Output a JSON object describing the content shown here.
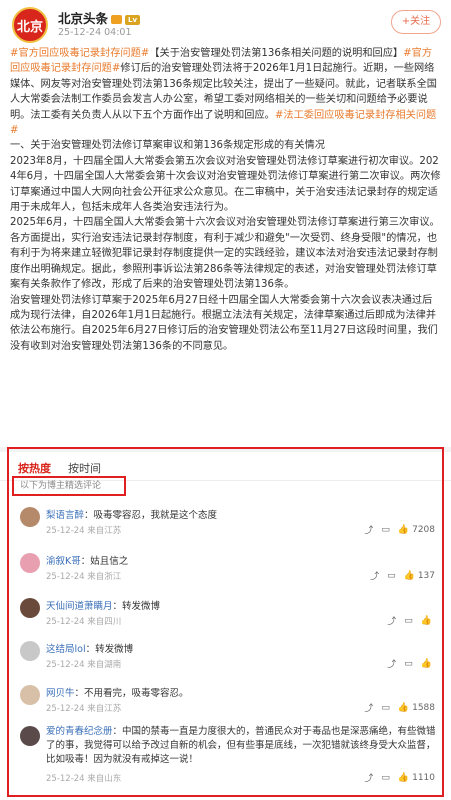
{
  "header": {
    "account_name": "北京头条",
    "avatar_text": "北京",
    "level_badge": "Lv",
    "timestamp": "25-12-24 04:01",
    "follow_label": "+关注"
  },
  "post": {
    "tag1": "#官方回应吸毒记录封存问题#",
    "text1": "【关于治安管理处罚法第136条相关问题的说明和回应】",
    "tag2": "#官方回应吸毒记录封存问题#",
    "text2": "修订后的治安管理处罚法将于2026年1月1日起施行。近期，一些网络媒体、网友等对治安管理处罚法第136条规定比较关注，提出了一些疑问。就此，记者联系全国人大常委会法制工作委员会发言人办公室，希望工委对网络相关的一些关切和问题给予必要说明。法工委有关负责人从以下五个方面作出了说明和回应。",
    "tag3": "#法工委回应吸毒记录封存相关问题#",
    "para1_title": "一、关于治安管理处罚法修订草案审议和第136条规定形成的有关情况",
    "para1_body": "2023年8月，十四届全国人大常委会第五次会议对治安管理处罚法修订草案进行初次审议。2024年6月，十四届全国人大常委会第十次会议对治安管理处罚法修订草案进行第二次审议。两次修订草案通过中国人大网向社会公开征求公众意见。在二审稿中，关于治安违法记录封存的规定适用于未成年人，包括未成年人各类治安违法行为。",
    "para2_body": "2025年6月，十四届全国人大常委会第十六次会议对治安管理处罚法修订草案进行第三次审议。各方面提出，实行治安违法记录封存制度，有利于减少和避免\"一次受罚、终身受限\"的情况，也有利于为将来建立轻微犯罪记录封存制度提供一定的实践经验，建议本法对治安违法记录封存制度作出明确规定。据此，参照刑事诉讼法第286条等法律规定的表述，对治安管理处罚法修订草案有关条款作了修改，形成了后来的治安管理处罚法第136条。",
    "para3_body": "治安管理处罚法修订草案于2025年6月27日经十四届全国人大常委会第十六次会议表决通过后成为现行法律，自2026年1月1日起施行。根据立法法有关规定，法律草案通过后即成为法律并依法公布施行。自2025年6月27日修订后的治安管理处罚法公布至11月27日这段时间里，我们没有收到对治安管理处罚法第136条的不同意见。"
  },
  "tabs": {
    "hot": "按热度",
    "time": "按时间"
  },
  "filter_note": "以下为博主精选评论",
  "comments": [
    {
      "user": "梨语言醉",
      "text": "吸毒零容忍，我就是这个态度",
      "time": "25-12-24",
      "loc": "来自江苏",
      "likes": "7208",
      "avatar_color": "#b58a6a"
    },
    {
      "user": "渝叙K哥",
      "text": "姑且信之",
      "time": "25-12-24",
      "loc": "来自浙江",
      "likes": "137",
      "avatar_color": "#e8a0b0"
    },
    {
      "user": "天仙间道萧瞒月",
      "text": "转发微博",
      "time": "25-12-24",
      "loc": "来自四川",
      "likes": "",
      "avatar_color": "#6a4a3a"
    },
    {
      "user": "这结局lol",
      "text": "转发微博",
      "time": "25-12-24",
      "loc": "来自湖南",
      "likes": "",
      "avatar_color": "#c8c8c8"
    },
    {
      "user": "网贝牛",
      "text": "不用看完，吸毒零容忍。",
      "time": "25-12-24",
      "loc": "来自江苏",
      "likes": "1588",
      "avatar_color": "#d8c0a8"
    },
    {
      "user": "爱的青春纪念册",
      "text": "中国的禁毒一直是力度很大的，普通民众对于毒品也是深恶痛绝，有些微错了的事，我觉得可以给予改过自新的机会，但有些事是底线，一次犯错就该终身受大众监督，比如吸毒！因为就没有戒掉这一说！",
      "time": "25-12-24",
      "loc": "来自山东",
      "likes": "1110",
      "avatar_color": "#5a4a4a"
    }
  ]
}
